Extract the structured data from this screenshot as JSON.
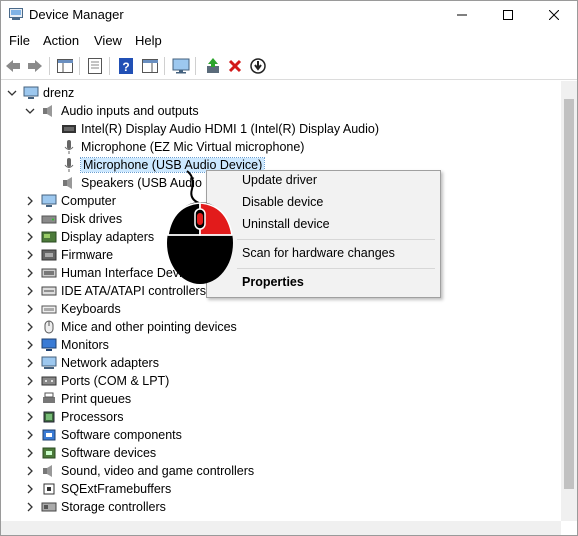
{
  "window": {
    "title": "Device Manager"
  },
  "menu": [
    "File",
    "Action",
    "View",
    "Help"
  ],
  "toolbar": [
    "back-icon",
    "forward-icon",
    "show-hide-console-tree-icon",
    "properties-icon",
    "help-icon",
    "action-pane-icon",
    "monitor-icon",
    "update-driver-icon",
    "uninstall-icon",
    "download-icon"
  ],
  "tree": {
    "root": "drenz",
    "audio_category": "Audio inputs and outputs",
    "audio_children": [
      "Intel(R) Display Audio HDMI 1 (Intel(R) Display Audio)",
      "Microphone (EZ Mic Virtual microphone)",
      "Microphone (USB Audio Device)",
      "Speakers (USB Audio Device)"
    ],
    "categories": [
      "Computer",
      "Disk drives",
      "Display adapters",
      "Firmware",
      "Human Interface Devices",
      "IDE ATA/ATAPI controllers",
      "Keyboards",
      "Mice and other pointing devices",
      "Monitors",
      "Network adapters",
      "Ports (COM & LPT)",
      "Print queues",
      "Processors",
      "Software components",
      "Software devices",
      "Sound, video and game controllers",
      "SQExtFramebuffers",
      "Storage controllers"
    ]
  },
  "context_menu": {
    "update_driver": "Update driver",
    "disable_device": "Disable device",
    "uninstall_device": "Uninstall device",
    "scan": "Scan for hardware changes",
    "properties": "Properties"
  },
  "colors": {
    "selection": "#cce8ff",
    "mouse_button_highlight": "#e21b1b"
  }
}
